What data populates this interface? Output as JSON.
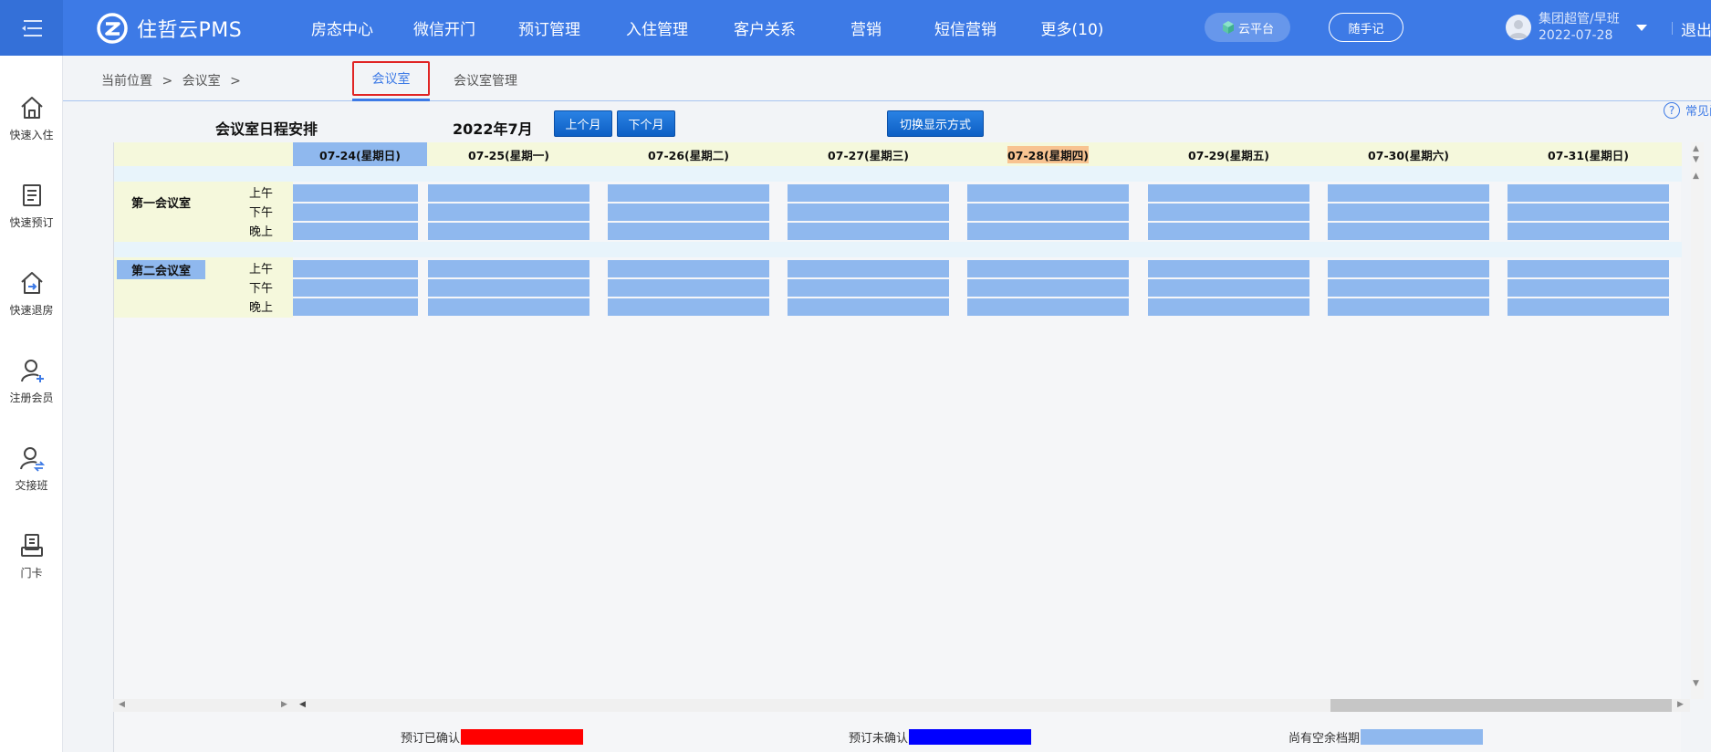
{
  "app": {
    "name": "住哲云PMS",
    "nav": [
      "房态中心",
      "微信开门",
      "预订管理",
      "入住管理",
      "客户关系",
      "营销",
      "短信营销",
      "更多(10)"
    ],
    "cloud_label": "云平台",
    "note_label": "随手记",
    "user_role": "集团超管/早班",
    "user_date": "2022-07-28",
    "logout_label": "退出"
  },
  "sidebar": {
    "items": [
      {
        "label": "快速入住",
        "icon": "home-icon"
      },
      {
        "label": "快速预订",
        "icon": "document-icon"
      },
      {
        "label": "快速退房",
        "icon": "checkout-icon"
      },
      {
        "label": "注册会员",
        "icon": "user-add-icon"
      },
      {
        "label": "交接班",
        "icon": "user-exchange-icon"
      },
      {
        "label": "门卡",
        "icon": "card-icon"
      }
    ]
  },
  "breadcrumb": {
    "prefix": "当前位置",
    "sep": ">",
    "current": "会议室",
    "tabs": [
      "会议室",
      "会议室管理"
    ]
  },
  "help_label": "常见问题",
  "schedule": {
    "title": "会议室日程安排",
    "month": "2022年7月",
    "prev_label": "上个月",
    "next_label": "下个月",
    "switch_label": "切换显示方式",
    "dates": [
      "07-24(星期日)",
      "07-25(星期一)",
      "07-26(星期二)",
      "07-27(星期三)",
      "07-28(星期四)",
      "07-29(星期五)",
      "07-30(星期六)",
      "07-31(星期日)"
    ],
    "selected_date": "07-24(星期日)",
    "today_date": "07-28(星期四)",
    "slots": [
      "上午",
      "下午",
      "晚上"
    ],
    "rooms": [
      {
        "name": "第一会议室",
        "highlighted": false
      },
      {
        "name": "第二会议室",
        "highlighted": true
      }
    ]
  },
  "legend": [
    {
      "label": "预订已确认",
      "color": "#ff0000"
    },
    {
      "label": "预订未确认",
      "color": "#0000ff"
    },
    {
      "label": "尚有空余档期",
      "color": "#8fb8ee"
    }
  ],
  "colors": {
    "primary": "#3d7ae6",
    "available": "#8fb8ee",
    "today": "#f8c391"
  }
}
